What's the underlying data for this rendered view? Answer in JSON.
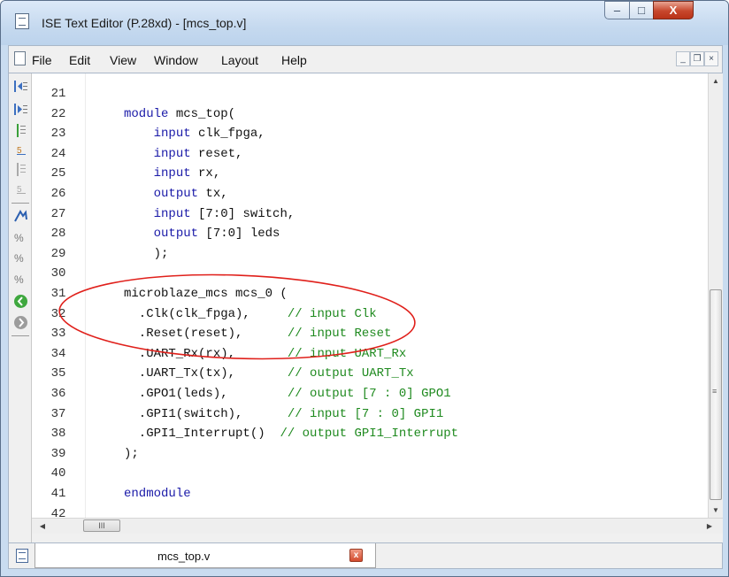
{
  "window": {
    "title": "ISE Text Editor (P.28xd) - [mcs_top.v]",
    "buttons": {
      "minimize": "–",
      "maximize": "□",
      "close": "X"
    }
  },
  "menu": {
    "items": [
      {
        "label": "File"
      },
      {
        "label": "Edit"
      },
      {
        "label": "View"
      },
      {
        "label": "Window"
      },
      {
        "label": "Layout"
      },
      {
        "label": "Help"
      }
    ],
    "mdi_buttons": {
      "minimize": "_",
      "restore": "❐",
      "close": "×"
    }
  },
  "toolbar": {
    "icons": [
      "indent-left-icon",
      "indent-right-icon",
      "comment-icon",
      "uncomment-icon",
      "comment-block-icon",
      "uncomment-block-icon",
      "bookmark-toggle-icon",
      "bookmark-next-icon",
      "bookmark-prev-icon",
      "bookmark-clear-icon",
      "go-forward-icon",
      "go-back-icon"
    ]
  },
  "editor": {
    "lines": [
      {
        "n": "21",
        "segments": []
      },
      {
        "n": "22",
        "segments": [
          {
            "t": "module ",
            "c": "kw"
          },
          {
            "t": "mcs_top(",
            "c": "txt"
          }
        ]
      },
      {
        "n": "23",
        "segments": [
          {
            "t": "    ",
            "c": "txt"
          },
          {
            "t": "input ",
            "c": "kw"
          },
          {
            "t": "clk_fpga,",
            "c": "txt"
          }
        ]
      },
      {
        "n": "24",
        "segments": [
          {
            "t": "    ",
            "c": "txt"
          },
          {
            "t": "input ",
            "c": "kw"
          },
          {
            "t": "reset,",
            "c": "txt"
          }
        ]
      },
      {
        "n": "25",
        "segments": [
          {
            "t": "    ",
            "c": "txt"
          },
          {
            "t": "input ",
            "c": "kw"
          },
          {
            "t": "rx,",
            "c": "txt"
          }
        ]
      },
      {
        "n": "26",
        "segments": [
          {
            "t": "    ",
            "c": "txt"
          },
          {
            "t": "output ",
            "c": "kw"
          },
          {
            "t": "tx,",
            "c": "txt"
          }
        ]
      },
      {
        "n": "27",
        "segments": [
          {
            "t": "    ",
            "c": "txt"
          },
          {
            "t": "input ",
            "c": "kw"
          },
          {
            "t": "[7:0] switch,",
            "c": "txt"
          }
        ]
      },
      {
        "n": "28",
        "segments": [
          {
            "t": "    ",
            "c": "txt"
          },
          {
            "t": "output ",
            "c": "kw"
          },
          {
            "t": "[7:0] leds",
            "c": "txt"
          }
        ]
      },
      {
        "n": "29",
        "segments": [
          {
            "t": "    );",
            "c": "txt"
          }
        ]
      },
      {
        "n": "30",
        "segments": []
      },
      {
        "n": "31",
        "segments": [
          {
            "t": "microblaze_mcs mcs_0 (",
            "c": "txt"
          }
        ]
      },
      {
        "n": "32",
        "segments": [
          {
            "t": "  .Clk(clk_fpga),     ",
            "c": "txt"
          },
          {
            "t": "// input Clk",
            "c": "cm"
          }
        ]
      },
      {
        "n": "33",
        "segments": [
          {
            "t": "  .Reset(reset),      ",
            "c": "txt"
          },
          {
            "t": "// input Reset",
            "c": "cm"
          }
        ]
      },
      {
        "n": "34",
        "segments": [
          {
            "t": "  .UART_Rx(rx),       ",
            "c": "txt"
          },
          {
            "t": "// input UART_Rx",
            "c": "cm"
          }
        ]
      },
      {
        "n": "35",
        "segments": [
          {
            "t": "  .UART_Tx(tx),       ",
            "c": "txt"
          },
          {
            "t": "// output UART_Tx",
            "c": "cm"
          }
        ]
      },
      {
        "n": "36",
        "segments": [
          {
            "t": "  .GPO1(leds),        ",
            "c": "txt"
          },
          {
            "t": "// output [7 : 0] GPO1",
            "c": "cm"
          }
        ]
      },
      {
        "n": "37",
        "segments": [
          {
            "t": "  .GPI1(switch),      ",
            "c": "txt"
          },
          {
            "t": "// input [7 : 0] GPI1",
            "c": "cm"
          }
        ]
      },
      {
        "n": "38",
        "segments": [
          {
            "t": "  .GPI1_Interrupt()  ",
            "c": "txt"
          },
          {
            "t": "// output GPI1_Interrupt",
            "c": "cm"
          }
        ]
      },
      {
        "n": "39",
        "segments": [
          {
            "t": ");",
            "c": "txt"
          }
        ]
      },
      {
        "n": "40",
        "segments": []
      },
      {
        "n": "41",
        "segments": [
          {
            "t": "endmodule",
            "c": "kw"
          }
        ]
      },
      {
        "n": "42",
        "segments": []
      }
    ]
  },
  "scrollbars": {
    "hthumb_grip": "III",
    "vthumb_grip": "≡"
  },
  "tabs": [
    {
      "label": "mcs_top.v",
      "close": "x"
    }
  ],
  "colors": {
    "keyword": "#1a1aa8",
    "comment": "#1f8a1f",
    "annotation": "#e0201b"
  }
}
